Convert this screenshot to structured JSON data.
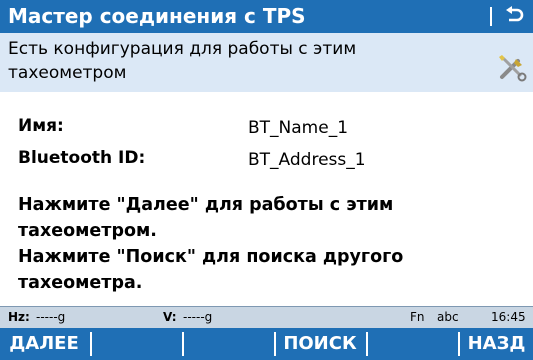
{
  "title_bar": {
    "title": "Мастер соединения с TPS",
    "back_icon": "back-arrow-icon"
  },
  "banner": {
    "message": "Есть конфигурация для работы с этим тахеометром",
    "icon": "tools-icon"
  },
  "fields": {
    "name_label": "Имя:",
    "name_value": "BT_Name_1",
    "bt_label": "Bluetooth ID:",
    "bt_value": "BT_Address_1"
  },
  "instructions": {
    "line1": "Нажмите \"Далее\" для работы с этим тахеометром.",
    "line2": "Нажмите \"Поиск\" для поиска другого тахеометра."
  },
  "status_bar": {
    "hz_label": "Hz:",
    "hz_value": "-----g",
    "v_label": "V:",
    "v_value": "-----g",
    "fn": "Fn",
    "input_mode": "abc",
    "time": "16:45"
  },
  "softkeys": {
    "f1": "ДАЛЕЕ",
    "f2": "",
    "f3": "ПОИСК",
    "f4": "",
    "f6": "НАЗД"
  },
  "colors": {
    "accent": "#1f6fb5",
    "banner_bg": "#dbe8f6",
    "status_bg": "#c9d6e3"
  }
}
